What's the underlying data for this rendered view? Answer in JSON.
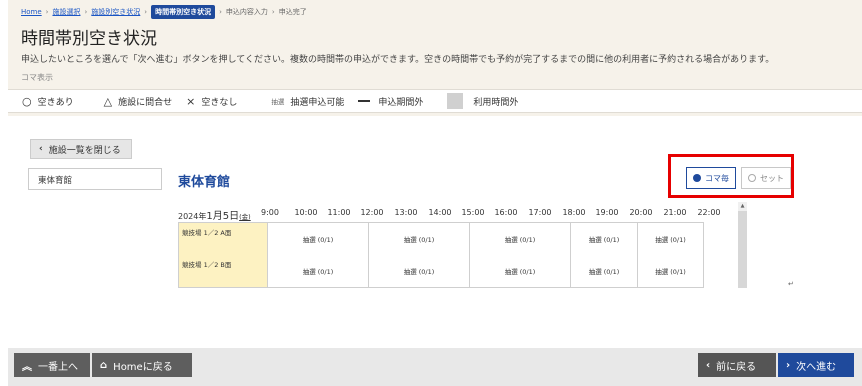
{
  "breadcrumb": {
    "home": "Home",
    "facility_select": "施設選択",
    "facility_vacancy": "施設別空き状況",
    "current": "時間帯別空き状況",
    "application_input": "申込内容入力",
    "application_done": "申込完了"
  },
  "page": {
    "title": "時間帯別空き状況",
    "instructions": "申込したいところを選んで「次へ進む」ボタンを押してください。複数の時間帯の申込ができます。空きの時間帯でも予約が完了するまでの間に他の利用者に予約される場合があります。",
    "koma_label": "コマ表示"
  },
  "legend": [
    {
      "symbol": "○",
      "label": "空きあり"
    },
    {
      "symbol": "△",
      "label": "施設に問合せ"
    },
    {
      "symbol": "×",
      "label": "空きなし"
    },
    {
      "symbol": "抽選",
      "label": "抽選申込可能"
    },
    {
      "symbol": "dash",
      "label": "申込期間外"
    },
    {
      "symbol": "gray",
      "label": "利用時間外"
    }
  ],
  "close_button": "施設一覧を閉じる",
  "facility_list_item": "東体育館",
  "facility_name": "東体育館",
  "mode": {
    "koma": "コマ毎",
    "set": "セット",
    "selected": "コマ毎"
  },
  "timetable": {
    "date_year": "2024年",
    "date_md": "1月5日",
    "date_dow": "(金)",
    "hours": [
      "9:00",
      "10:00",
      "11:00",
      "12:00",
      "13:00",
      "14:00",
      "15:00",
      "16:00",
      "17:00",
      "18:00",
      "19:00",
      "20:00",
      "21:00",
      "22:00"
    ],
    "rooms": [
      {
        "name": "競技場 1／2 A面",
        "slots": [
          "抽選 (0/1)",
          "抽選 (0/1)",
          "抽選 (0/1)",
          "抽選 (0/1)",
          "抽選 (0/1)"
        ]
      },
      {
        "name": "競技場 1／2 B面",
        "slots": [
          "抽選 (0/1)",
          "抽選 (0/1)",
          "抽選 (0/1)",
          "抽選 (0/1)",
          "抽選 (0/1)"
        ]
      }
    ]
  },
  "footer": {
    "to_top": "一番上へ",
    "home": "Homeに戻る",
    "prev": "前に戻る",
    "next": "次へ進む"
  },
  "colors": {
    "accent": "#1f4a9c",
    "highlight_border": "#e60000",
    "room_bg": "#fdf2c2",
    "header_bg": "#f6f2ea"
  }
}
